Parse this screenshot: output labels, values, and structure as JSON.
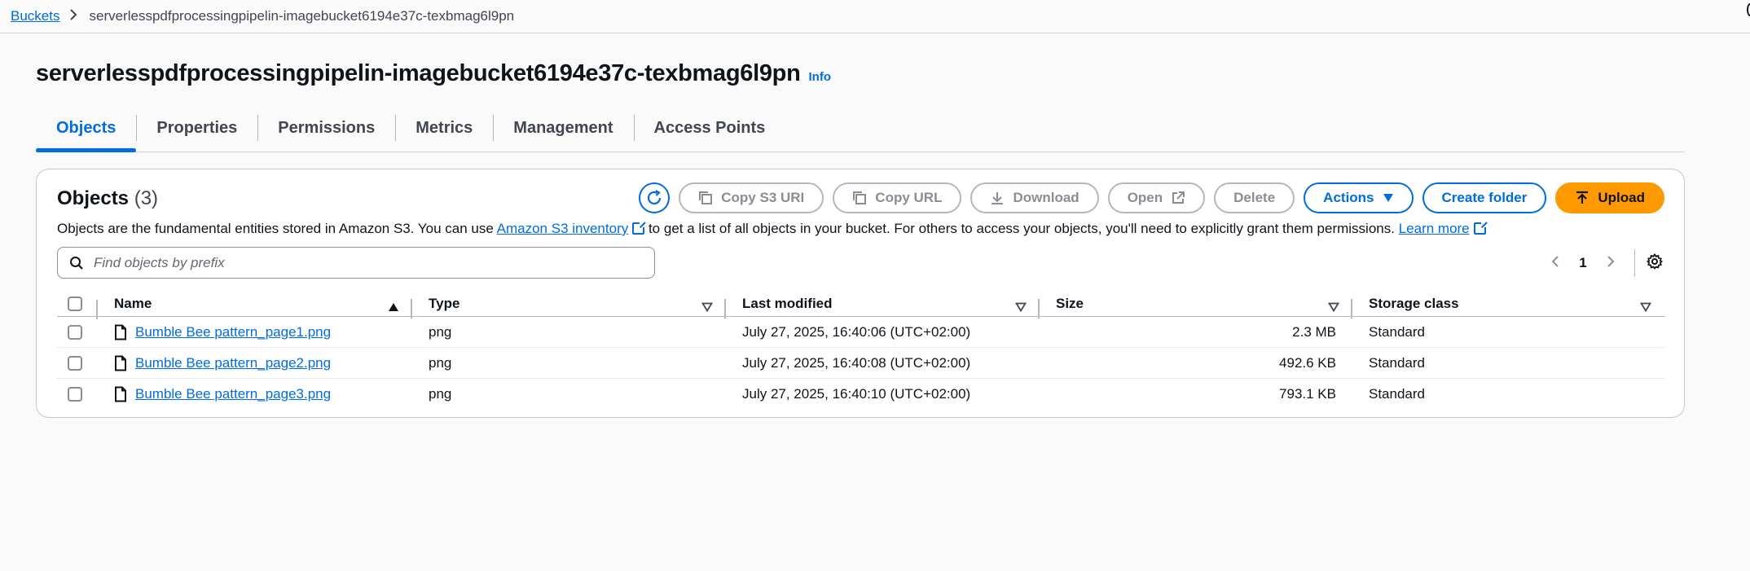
{
  "breadcrumb": {
    "root": "Buckets",
    "current": "serverlesspdfprocessingpipelin-imagebucket6194e37c-texbmag6l9pn"
  },
  "header": {
    "title": "serverlesspdfprocessingpipelin-imagebucket6194e37c-texbmag6l9pn",
    "info": "Info"
  },
  "tabs": [
    {
      "label": "Objects",
      "active": true
    },
    {
      "label": "Properties"
    },
    {
      "label": "Permissions"
    },
    {
      "label": "Metrics"
    },
    {
      "label": "Management"
    },
    {
      "label": "Access Points"
    }
  ],
  "objects_panel": {
    "title": "Objects",
    "count": "(3)",
    "description_1": "Objects are the fundamental entities stored in Amazon S3. You can use ",
    "inventory_link": "Amazon S3 inventory",
    "description_2": " to get a list of all objects in your bucket. For others to access your objects, you'll need to explicitly grant them permissions. ",
    "learn_more": "Learn more",
    "search_placeholder": "Find objects by prefix",
    "page_number": "1"
  },
  "toolbar": {
    "copy_s3_uri": "Copy S3 URI",
    "copy_url": "Copy URL",
    "download": "Download",
    "open": "Open",
    "delete": "Delete",
    "actions": "Actions",
    "create_folder": "Create folder",
    "upload": "Upload"
  },
  "table": {
    "columns": [
      "Name",
      "Type",
      "Last modified",
      "Size",
      "Storage class"
    ],
    "rows": [
      {
        "name": "Bumble Bee pattern_page1.png",
        "type": "png",
        "modified": "July 27, 2025, 16:40:06 (UTC+02:00)",
        "size": "2.3 MB",
        "storage": "Standard"
      },
      {
        "name": "Bumble Bee pattern_page2.png",
        "type": "png",
        "modified": "July 27, 2025, 16:40:08 (UTC+02:00)",
        "size": "492.6 KB",
        "storage": "Standard"
      },
      {
        "name": "Bumble Bee pattern_page3.png",
        "type": "png",
        "modified": "July 27, 2025, 16:40:10 (UTC+02:00)",
        "size": "793.1 KB",
        "storage": "Standard"
      }
    ]
  },
  "colors": {
    "link": "#006ce0",
    "upload": "#ff9900",
    "border": "#c6c6cd"
  }
}
